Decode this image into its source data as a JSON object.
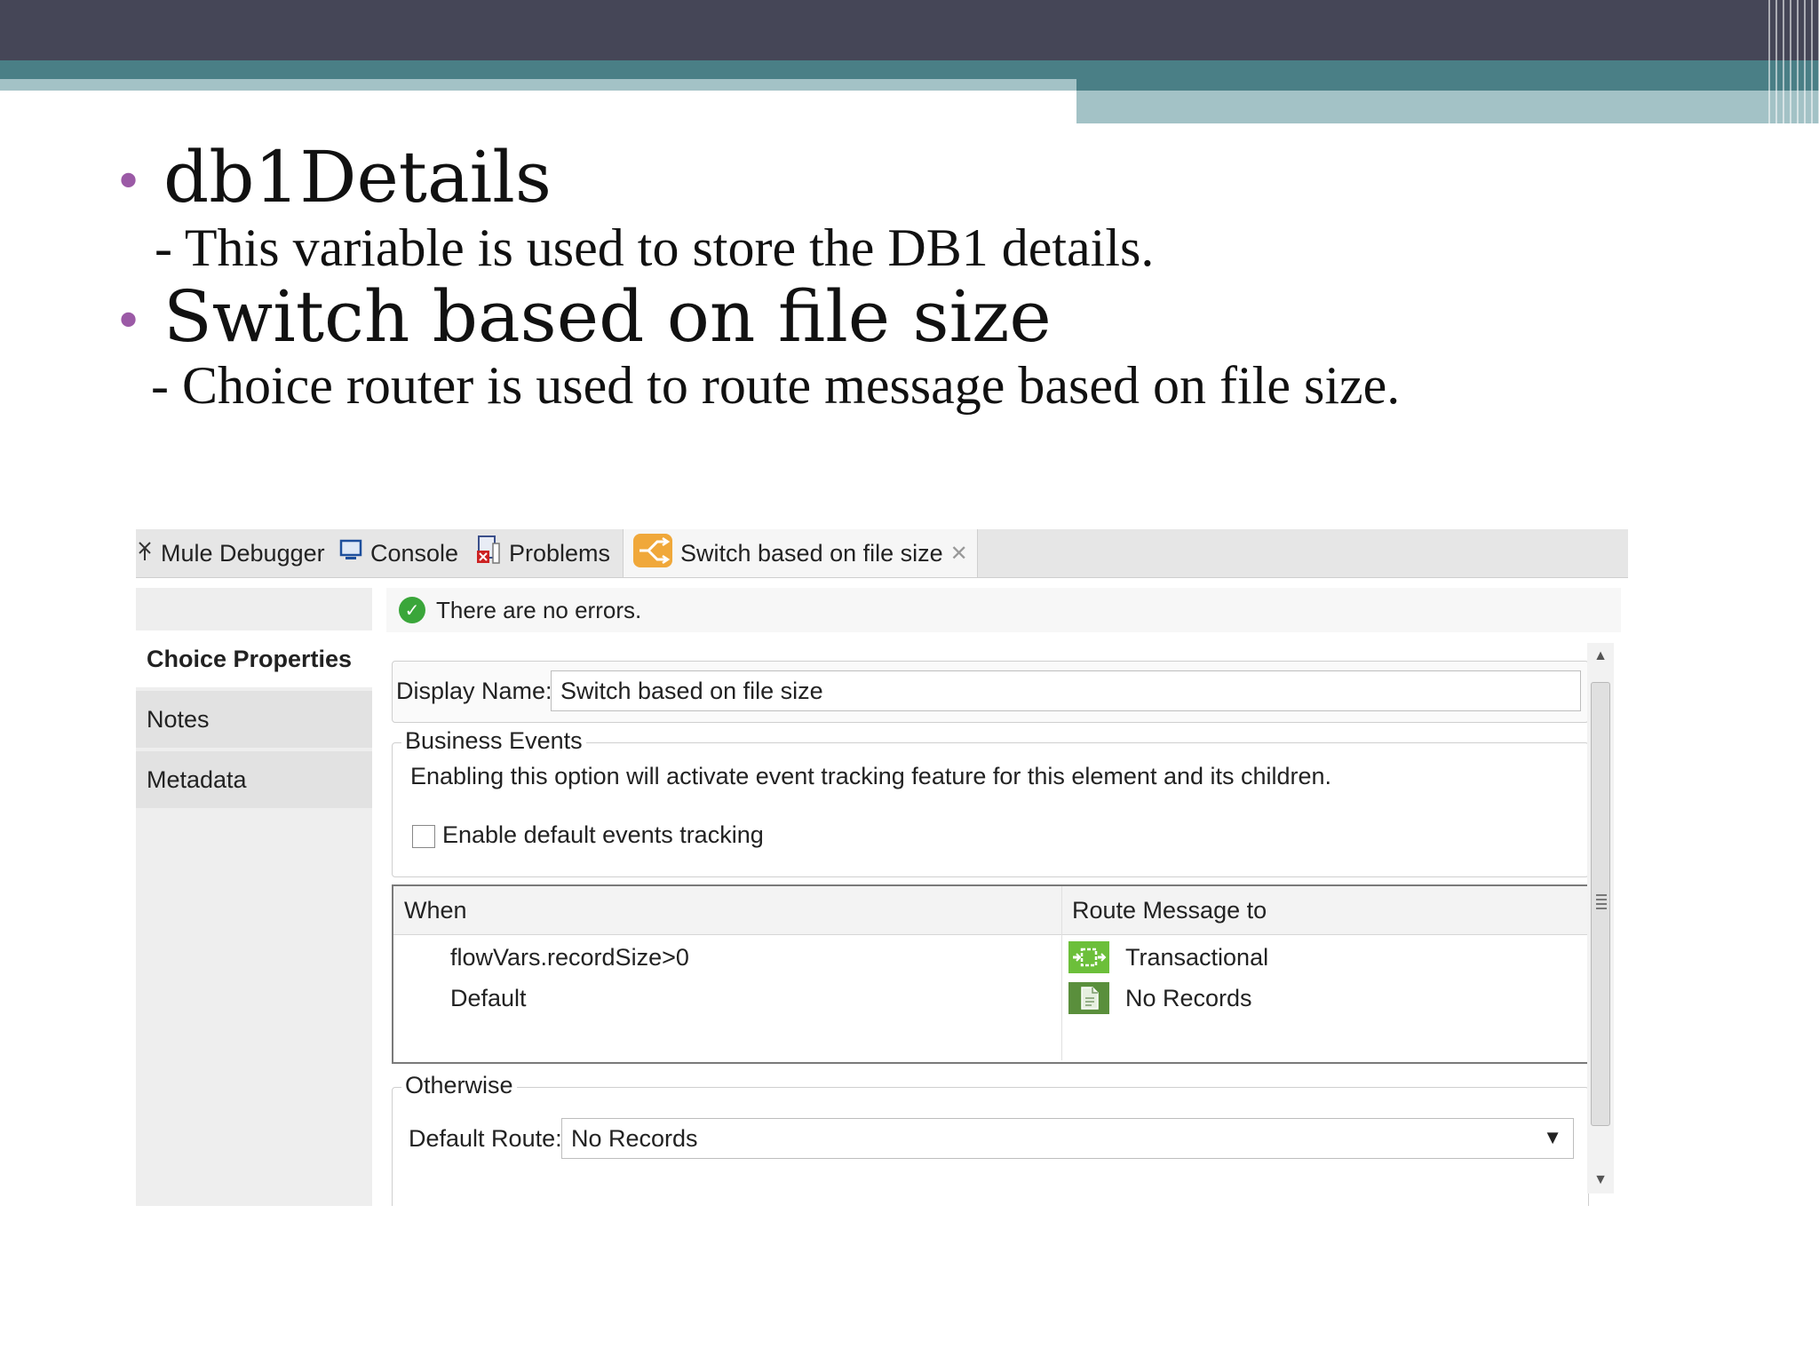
{
  "slide": {
    "bullet1": "db1Details",
    "sub1": "- This variable is used to store the DB1 details.",
    "bullet2": "Switch based on file size",
    "sub2": "- Choice router is used to route message based on file size."
  },
  "tabs": [
    {
      "label": "Mule Debugger",
      "icon": "bug-icon"
    },
    {
      "label": "Console",
      "icon": "console-icon"
    },
    {
      "label": "Problems",
      "icon": "problems-icon"
    },
    {
      "label": "Switch based on file size",
      "icon": "choice-router-icon",
      "active": true
    }
  ],
  "close_symbol": "✕",
  "leftnav": {
    "items": [
      "Choice Properties",
      "Notes",
      "Metadata"
    ]
  },
  "status": {
    "text": "There are no errors."
  },
  "display_name": {
    "label": "Display Name:",
    "value": "Switch based on file size"
  },
  "business_events": {
    "legend": "Business Events",
    "description": "Enabling this option will activate event tracking feature for this element and its children.",
    "checkbox_label": "Enable default events tracking",
    "checked": false
  },
  "routes": {
    "columns": [
      "When",
      "Route Message to"
    ],
    "rows": [
      {
        "when": "flowVars.recordSize>0",
        "route": "Transactional",
        "icon": "transactional-icon"
      },
      {
        "when": "Default",
        "route": "No Records",
        "icon": "flow-ref-icon"
      }
    ]
  },
  "otherwise": {
    "legend": "Otherwise",
    "label": "Default Route:",
    "value": "No Records"
  },
  "colors": {
    "header_dark": "#454657",
    "header_teal": "#4a7f86",
    "header_light": "#a3c2c6",
    "bullet": "#9b5aa6",
    "success": "#3aa63a"
  }
}
